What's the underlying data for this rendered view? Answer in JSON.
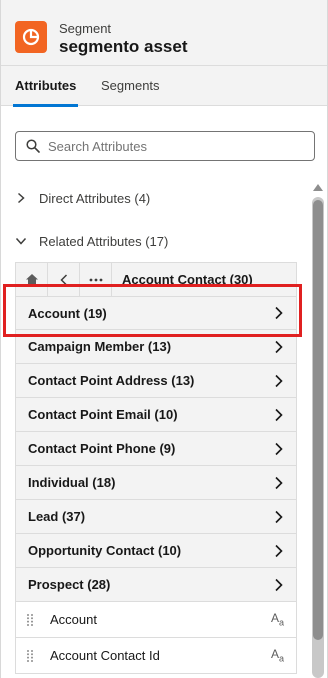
{
  "header": {
    "kind": "Segment",
    "title": "segmento asset",
    "icon": "segment-icon",
    "accent": "#f26522"
  },
  "tabs": [
    {
      "label": "Attributes",
      "active": true
    },
    {
      "label": "Segments",
      "active": false
    }
  ],
  "search": {
    "placeholder": "Search Attributes",
    "value": ""
  },
  "sections": {
    "direct": {
      "label": "Direct Attributes (4)",
      "expanded": false
    },
    "related": {
      "label": "Related Attributes (17)",
      "expanded": true
    }
  },
  "breadcrumb": {
    "title": "Account Contact (30)",
    "icons": [
      "home-icon",
      "back-icon",
      "more-icon"
    ]
  },
  "related_objects": [
    {
      "label": "Account (19)"
    },
    {
      "label": "Campaign Member (13)"
    },
    {
      "label": "Contact Point Address (13)"
    },
    {
      "label": "Contact Point Email (10)"
    },
    {
      "label": "Contact Point Phone (9)"
    },
    {
      "label": "Individual (18)"
    },
    {
      "label": "Lead (37)"
    },
    {
      "label": "Opportunity Contact (10)"
    },
    {
      "label": "Prospect (28)"
    }
  ],
  "fields": [
    {
      "label": "Account",
      "type_main": "A",
      "type_sub": "a"
    },
    {
      "label": "Account Contact Id",
      "type_main": "A",
      "type_sub": "a"
    }
  ],
  "colors": {
    "highlight": "#e02020",
    "tab_active": "#0176d3"
  }
}
